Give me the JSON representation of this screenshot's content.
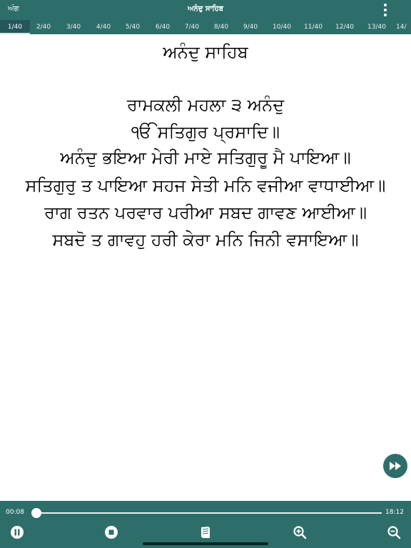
{
  "header": {
    "left_label": "ਅੰਗ",
    "title": "ਅਨੰਦੁ ਸਾਹਿਬ"
  },
  "pages": {
    "active_index": 0,
    "tabs": [
      "1/40",
      "2/40",
      "3/40",
      "4/40",
      "5/40",
      "6/40",
      "7/40",
      "8/40",
      "9/40",
      "10/40",
      "11/40",
      "12/40",
      "13/40",
      "14/"
    ]
  },
  "content": {
    "heading": "ਅਨੰਦੁ ਸਾਹਿਬ",
    "verses": [
      "ਰਾਮਕਲੀ ਮਹਲਾ ੩ ਅਨੰਦੁ",
      "ੴ ਸਤਿਗੁਰ ਪ੍ਰਸਾਦਿ॥",
      "ਅਨੰਦੁ ਭਇਆ ਮੇਰੀ ਮਾਏ ਸਤਿਗੁਰੂ ਮੈ ਪਾਇਆ॥",
      "ਸਤਿਗੁਰੁ ਤ ਪਾਇਆ ਸਹਜ ਸੇਤੀ ਮਨਿ ਵਜੀਆ ਵਾਧਾਈਆ॥",
      "ਰਾਗ ਰਤਨ ਪਰਵਾਰ ਪਰੀਆ ਸਬਦ ਗਾਵਣ ਆਈਆ॥",
      "ਸਬਦੋ ਤ ਗਾਵਹੁ ਹਰੀ ਕੇਰਾ ਮਨਿ ਜਿਨੀ ਵਸਾਇਆ॥"
    ]
  },
  "player": {
    "elapsed": "00:08",
    "duration": "18:12",
    "progress": 0.007
  },
  "colors": {
    "bar": "#2e6e6a",
    "active_tab": "#25575a"
  },
  "icons": {
    "menu": "more-vertical-icon",
    "fast_forward": "fast-forward-icon",
    "pause": "pause-icon",
    "stop": "stop-icon",
    "book": "book-icon",
    "zoom_in": "zoom-in-icon",
    "zoom_out": "zoom-out-icon"
  }
}
